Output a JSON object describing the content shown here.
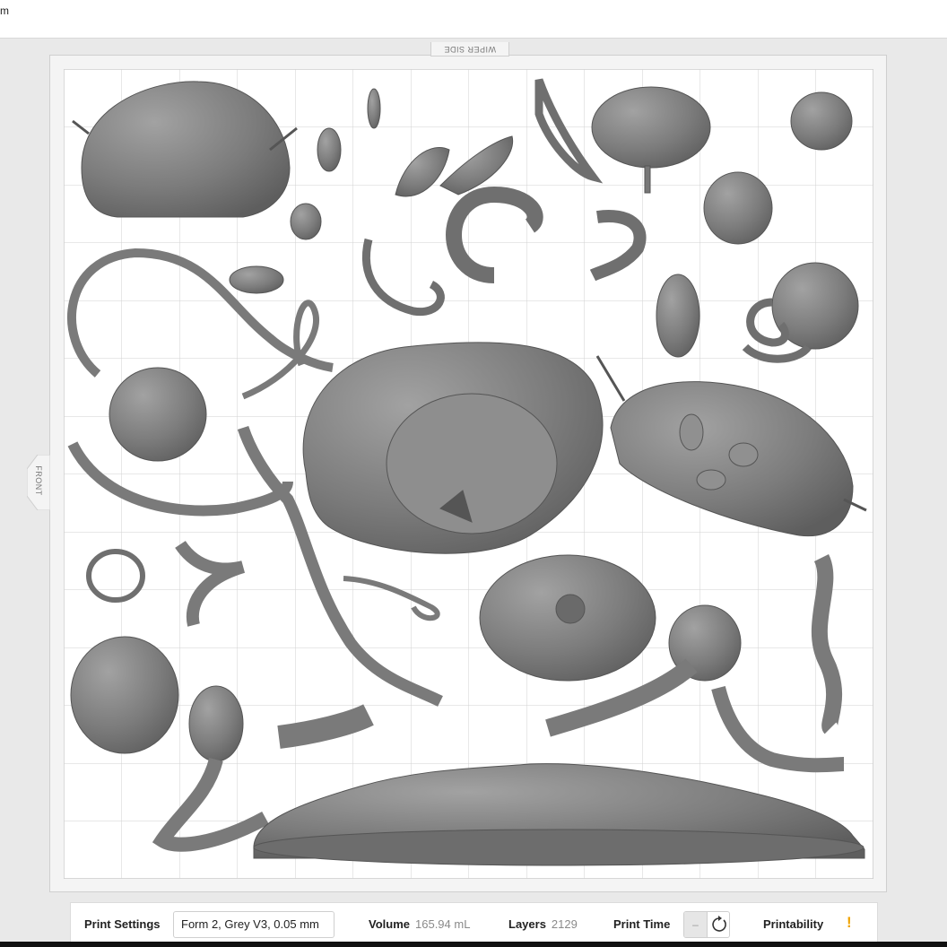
{
  "window": {
    "title_fragment": "m"
  },
  "viewport": {
    "wiper_side_label": "WIPER SIDE",
    "front_label": "FRONT"
  },
  "bottombar": {
    "print_settings_label": "Print Settings",
    "print_settings_value": "Form 2, Grey V3, 0.05 mm",
    "volume_label": "Volume",
    "volume_value": "165.94 mL",
    "layers_label": "Layers",
    "layers_value": "2129",
    "print_time_label": "Print Time",
    "print_time_value": "–",
    "printability_label": "Printability",
    "printability_status": "!"
  },
  "colors": {
    "model_grey": "#7c7c7c",
    "warning": "#f0a400",
    "grid_line": "#d2d2d2"
  },
  "icons": {
    "refresh": "refresh-icon",
    "warning": "warning-icon"
  }
}
